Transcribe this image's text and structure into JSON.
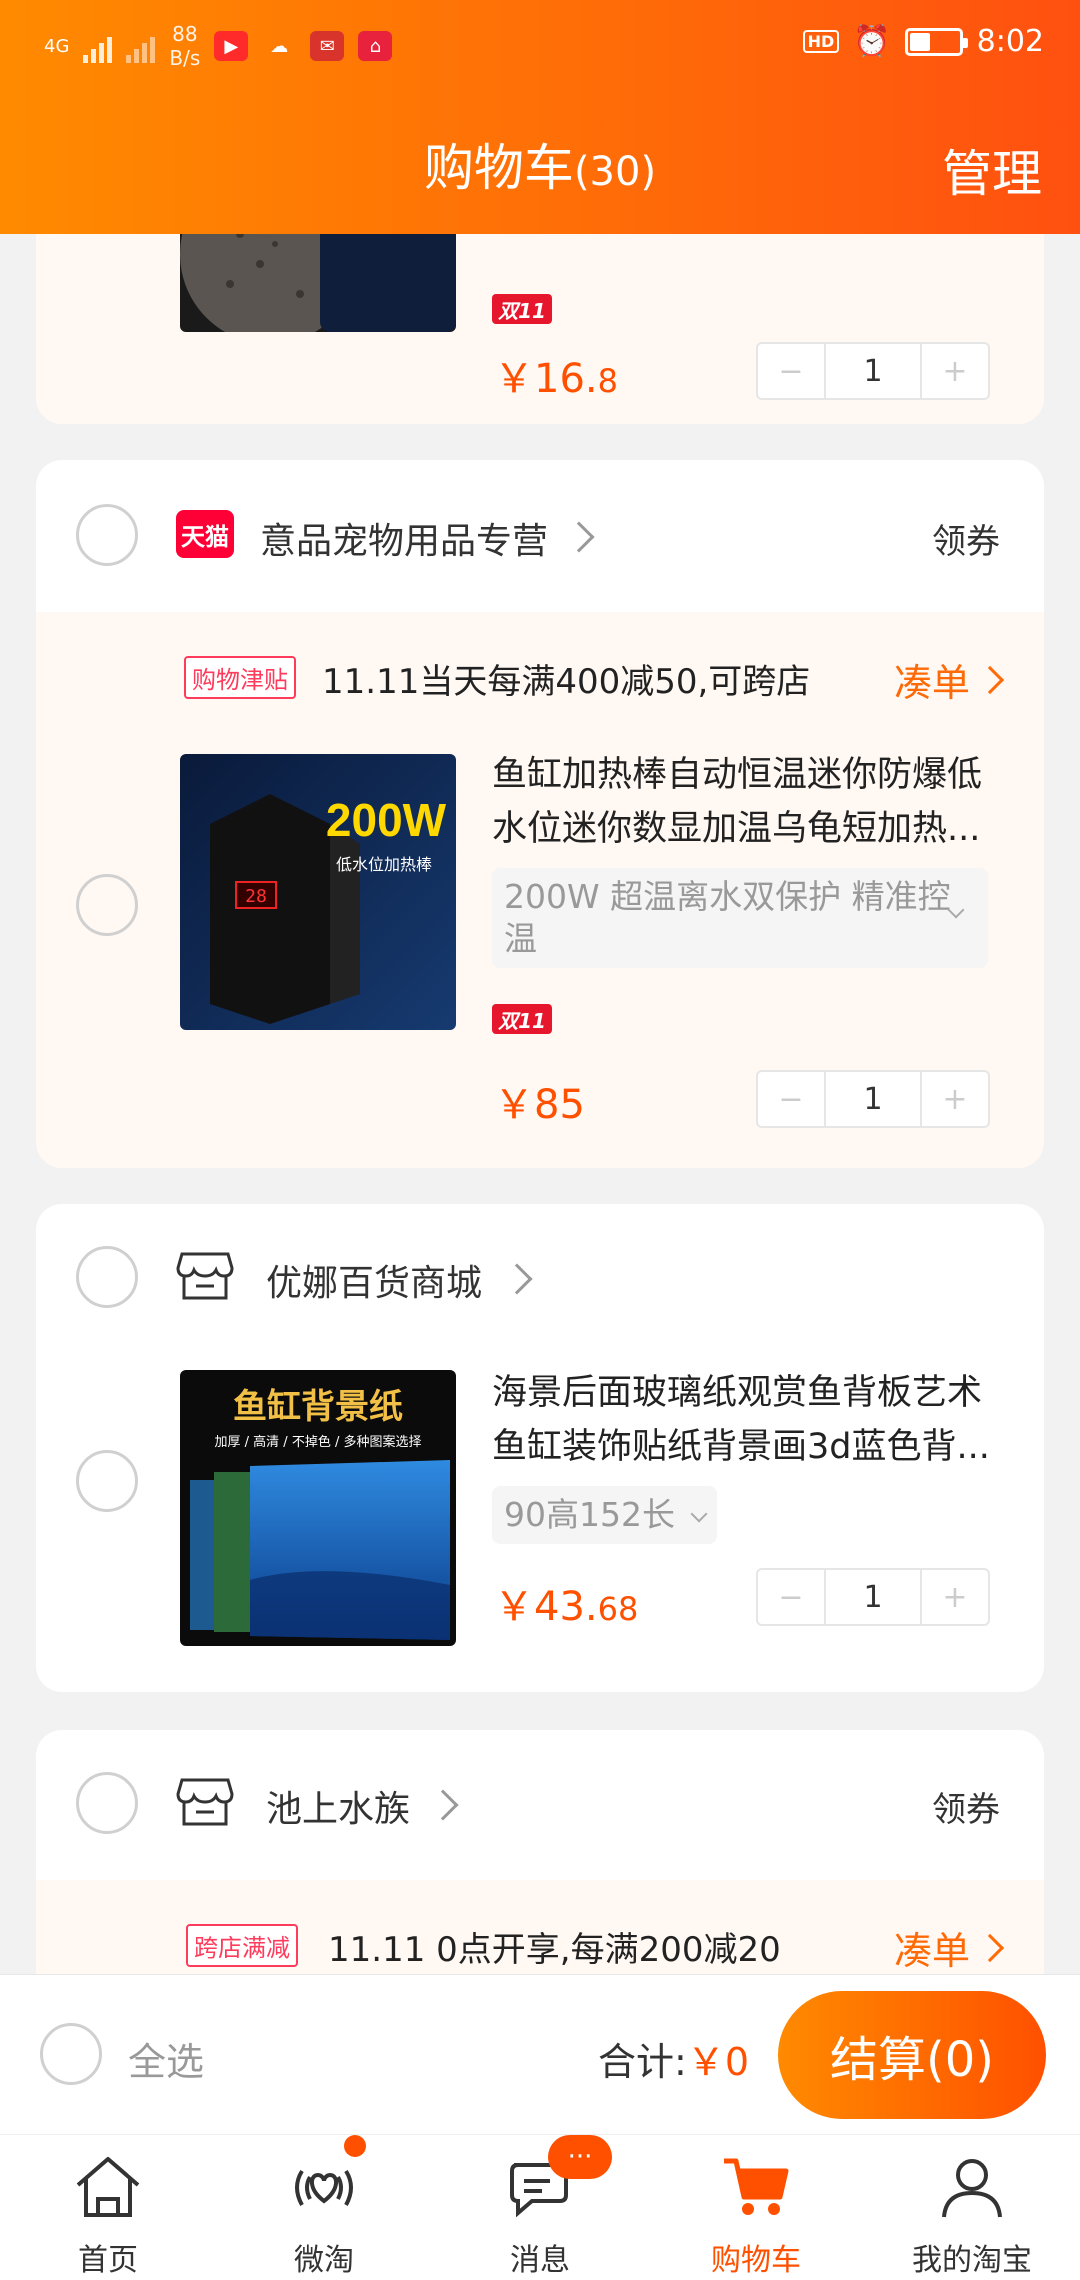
{
  "status_bar": {
    "net": "4G",
    "speed_value": "88",
    "speed_unit": "B/s",
    "time": "8:02",
    "hd": "HD",
    "battery_level": 0.4
  },
  "header": {
    "title": "购物车",
    "count": "(30)",
    "manage": "管理"
  },
  "top_item": {
    "price_int": "￥16.",
    "price_dec": "8",
    "qty": "1",
    "badge": "双11"
  },
  "shop1": {
    "name": "意品宠物用品专营",
    "coupon": "领券",
    "tmall_label": "天猫",
    "promo_tag": "购物津贴",
    "promo_text": "11.11当天每满400减50,可跨店",
    "promo_action": "凑单",
    "item": {
      "thumb_text": "200W",
      "thumb_sub": "低水位加热棒",
      "title": "鱼缸加热棒自动恒温迷你防爆低水位迷你数显加温乌龟短加热...",
      "sku": "200W 超温离水双保护 精准控温",
      "badge": "双11",
      "price": "￥85",
      "qty": "1"
    }
  },
  "shop2": {
    "name": "优娜百货商城",
    "item": {
      "thumb_text": "鱼缸背景纸",
      "thumb_sub": "加厚 / 高清 / 不掉色 / 多种图案选择",
      "title": "海景后面玻璃纸观赏鱼背板艺术鱼缸装饰贴纸背景画3d蓝色背...",
      "sku": "90高152长",
      "price_int": "￥43.",
      "price_dec": "68",
      "qty": "1"
    }
  },
  "shop3": {
    "name": "池上水族",
    "coupon": "领券",
    "promo_tag": "跨店满减",
    "promo_text": "11.11 0点开享,每满200减20",
    "promo_action": "凑单"
  },
  "footer": {
    "select_all": "全选",
    "total_label": "合计:",
    "total_value": "￥0",
    "checkout": "结算(0)"
  },
  "tabs": [
    {
      "label": "首页",
      "icon": "home-icon"
    },
    {
      "label": "微淘",
      "icon": "weitao-icon"
    },
    {
      "label": "消息",
      "icon": "message-icon",
      "bubble": "···"
    },
    {
      "label": "购物车",
      "icon": "cart-icon"
    },
    {
      "label": "我的淘宝",
      "icon": "profile-icon"
    }
  ],
  "colors": {
    "brand_orange": "#ff5000",
    "header_start": "#ff8a00",
    "card_pink": "#fff8f3",
    "tmall_red": "#ff0036"
  }
}
